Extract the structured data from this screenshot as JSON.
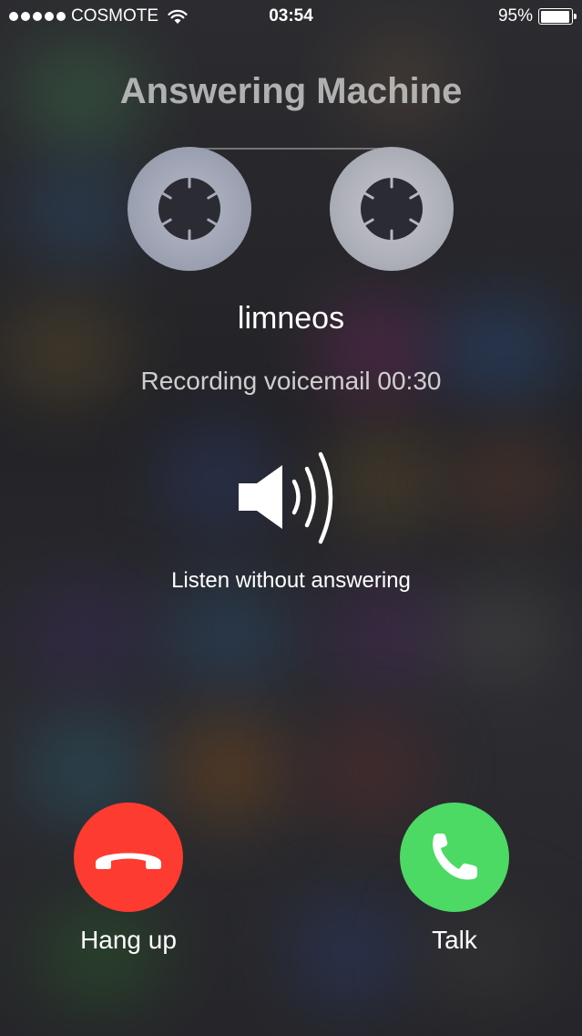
{
  "status_bar": {
    "carrier": "COSMOTE",
    "time": "03:54",
    "battery_percent": "95%",
    "battery_level": 0.95,
    "signal_bars": 5,
    "icons": [
      "signal-dots-icon",
      "wifi-icon",
      "battery-icon"
    ]
  },
  "screen": {
    "title": "Answering Machine",
    "caller_name": "limneos",
    "recording_status": "Recording voicemail 00:30",
    "listen_label": "Listen without answering"
  },
  "actions": {
    "hangup_label": "Hang up",
    "talk_label": "Talk",
    "hangup_color": "#fd3b30",
    "talk_color": "#4cd964",
    "icons": [
      "hang-up-phone-icon",
      "phone-icon",
      "speaker-icon",
      "tape-reel-icon"
    ]
  }
}
